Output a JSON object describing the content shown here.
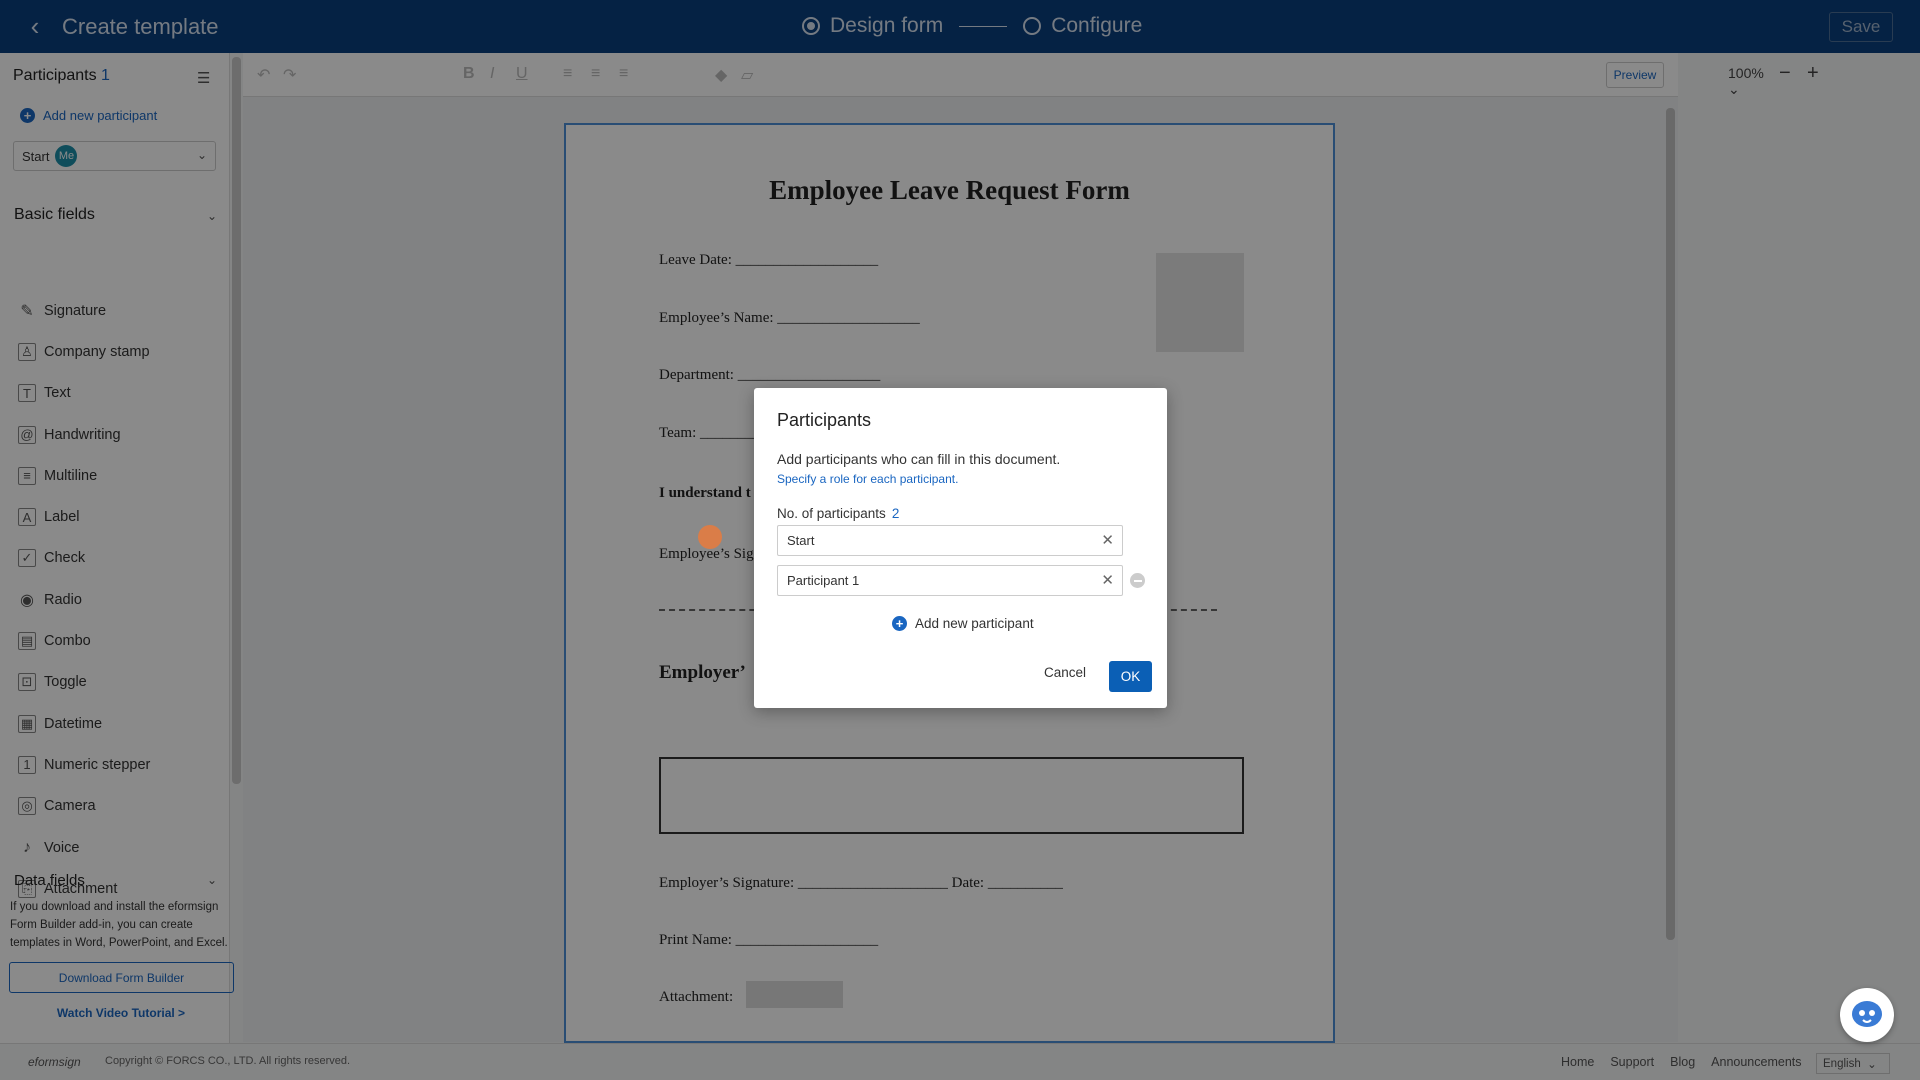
{
  "header": {
    "title": "Create template",
    "step1": "Design form",
    "step2": "Configure",
    "save": "Save"
  },
  "sidebar": {
    "participants_label": "Participants",
    "participants_count": "1",
    "add_participant": "Add new participant",
    "start_label": "Start",
    "me_badge": "Me",
    "basic_fields_label": "Basic fields",
    "fields": [
      {
        "label": "Signature",
        "icon": "pen-icon"
      },
      {
        "label": "Company stamp",
        "icon": "stamp-icon"
      },
      {
        "label": "Text",
        "icon": "text-icon"
      },
      {
        "label": "Handwriting",
        "icon": "handwriting-icon"
      },
      {
        "label": "Multiline",
        "icon": "multiline-icon"
      },
      {
        "label": "Label",
        "icon": "label-icon"
      },
      {
        "label": "Check",
        "icon": "check-icon"
      },
      {
        "label": "Radio",
        "icon": "radio-icon"
      },
      {
        "label": "Combo",
        "icon": "combo-icon"
      },
      {
        "label": "Toggle",
        "icon": "toggle-icon"
      },
      {
        "label": "Datetime",
        "icon": "calendar-icon"
      },
      {
        "label": "Numeric stepper",
        "icon": "stepper-icon"
      },
      {
        "label": "Camera",
        "icon": "camera-icon"
      },
      {
        "label": "Voice",
        "icon": "microphone-icon"
      },
      {
        "label": "Attachment",
        "icon": "attachment-icon"
      }
    ],
    "data_fields_label": "Data fields",
    "info_text": "If you download and install the eformsign Form Builder add-in, you can create templates in Word, PowerPoint, and Excel.",
    "download_btn": "Download Form Builder",
    "watch_link": "Watch Video Tutorial >"
  },
  "toolbar": {
    "zoom": "100%",
    "preview": "Preview"
  },
  "document": {
    "title": "Employee Leave Request Form",
    "line1": "Leave Date: ___________________",
    "line2": "Employee’s Name: ___________________",
    "line3": "Department: ___________________",
    "line4": "Team: __________",
    "line5": "I understand t",
    "line6": "Employee’s Sig",
    "line7": "Employer’",
    "line8": "Employer’s Signature: ____________________ Date: __________",
    "line9": "Print Name: ___________________",
    "line10": "Attachment:"
  },
  "dialog": {
    "title": "Participants",
    "desc": "Add participants who can fill in this document.",
    "link": "Specify a role for each participant.",
    "no_label": "No. of participants",
    "no_value": "2",
    "participants": [
      "Start",
      "Participant 1"
    ],
    "add": "Add new participant",
    "cancel": "Cancel",
    "ok": "OK"
  },
  "footer": {
    "logo": "eformsign",
    "copyright": "Copyright © FORCS CO., LTD. All rights reserved.",
    "links": [
      "Home",
      "Support",
      "Blog",
      "Announcements"
    ],
    "language": "English"
  }
}
